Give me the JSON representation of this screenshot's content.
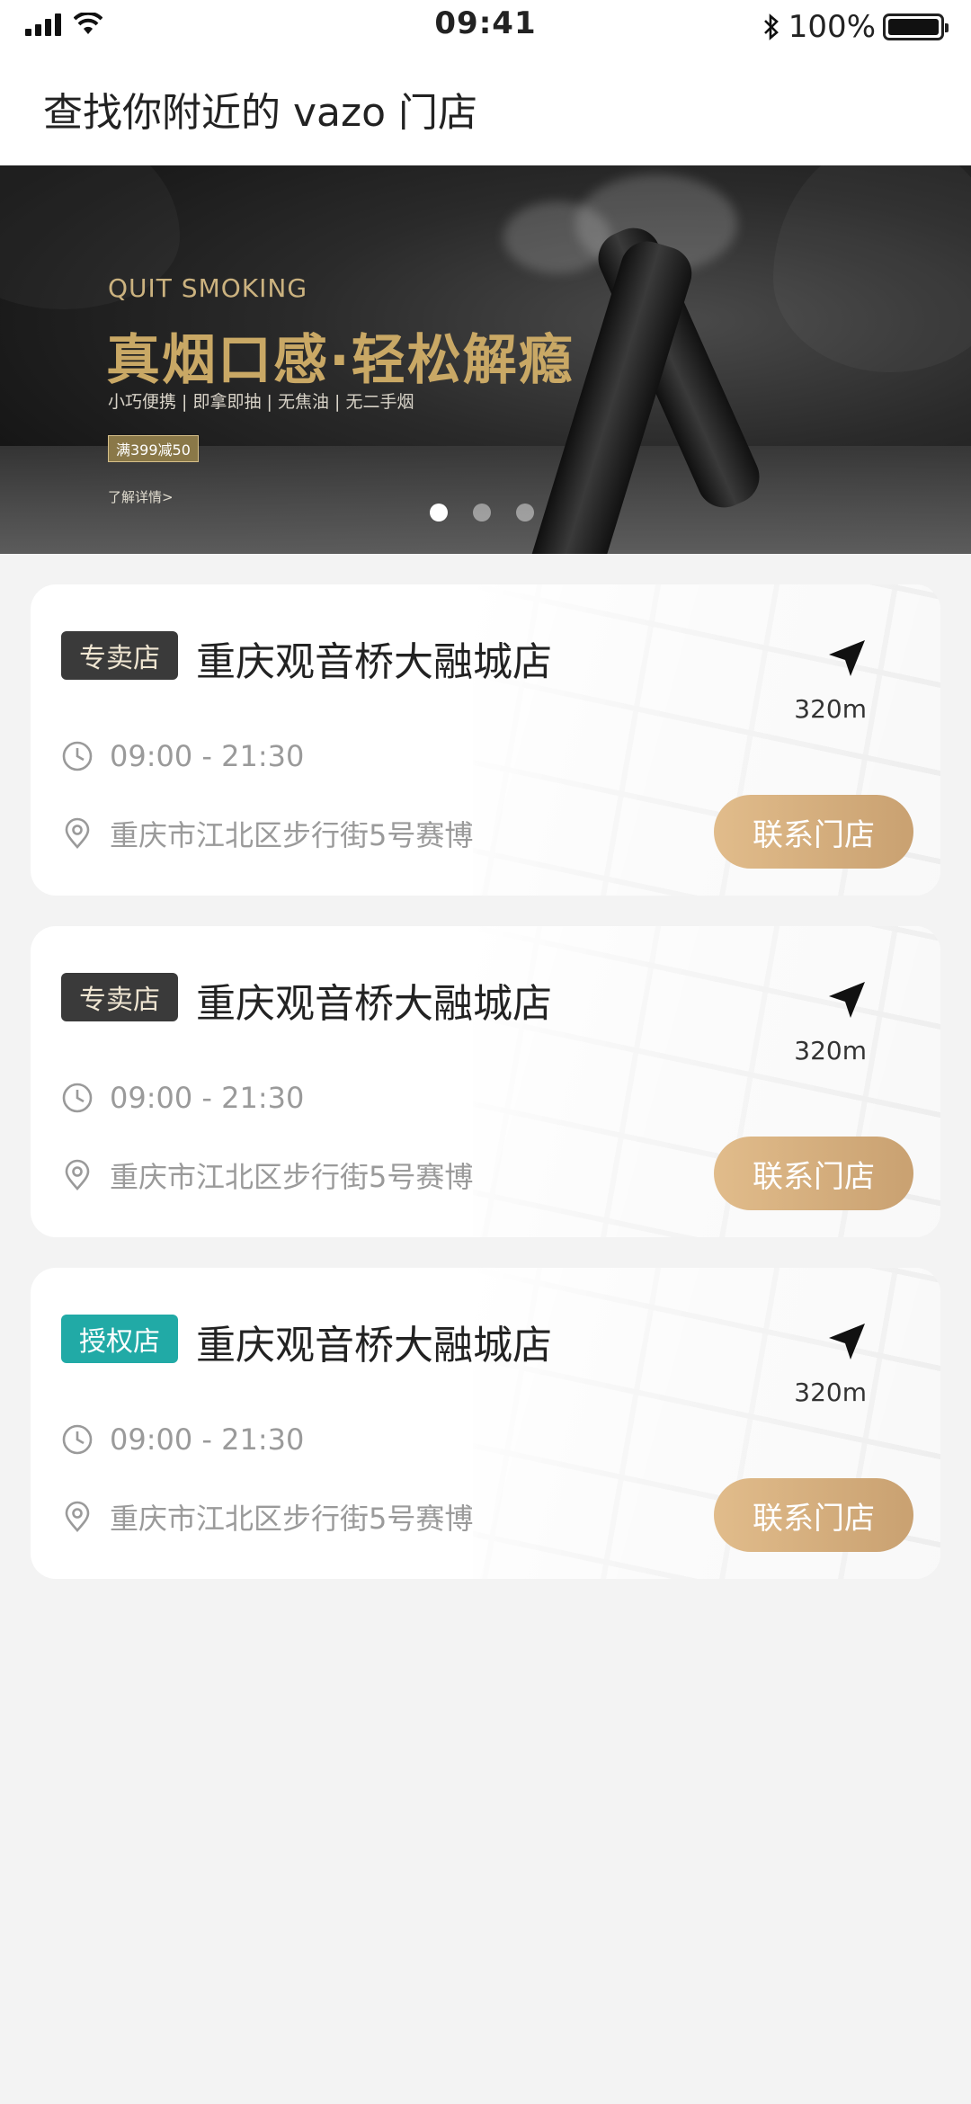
{
  "status_bar": {
    "time": "09:41",
    "battery": "100%"
  },
  "header": {
    "title": "查找你附近的 vazo 门店"
  },
  "banner": {
    "subtitle_en": "QUIT SMOKING",
    "headline": "真烟口感·轻松解瘾",
    "features": "小巧便携 | 即拿即抽 | 无焦油 | 无二手烟",
    "promo": "满399减50",
    "more_link": "了解详情>",
    "carousel": {
      "count": 3,
      "active_index": 0
    }
  },
  "stores": [
    {
      "badge": "专卖店",
      "badge_style": "dark",
      "name": "重庆观音桥大融城店",
      "distance": "320m",
      "hours": "09:00 - 21:30",
      "address": "重庆市江北区步行街5号赛博",
      "contact_label": "联系门店"
    },
    {
      "badge": "专卖店",
      "badge_style": "dark",
      "name": "重庆观音桥大融城店",
      "distance": "320m",
      "hours": "09:00 - 21:30",
      "address": "重庆市江北区步行街5号赛博",
      "contact_label": "联系门店"
    },
    {
      "badge": "授权店",
      "badge_style": "teal",
      "name": "重庆观音桥大融城店",
      "distance": "320m",
      "hours": "09:00 - 21:30",
      "address": "重庆市江北区步行街5号赛博",
      "contact_label": "联系门店"
    }
  ],
  "colors": {
    "accent_gold": "#c9a171",
    "badge_dark": "#3a3a3a",
    "badge_teal": "#21aaa6",
    "page_bg": "#f3f3f3"
  },
  "icons": {
    "navigate": "navigation-arrow-icon",
    "hours": "clock-icon",
    "address": "location-pin-icon"
  }
}
